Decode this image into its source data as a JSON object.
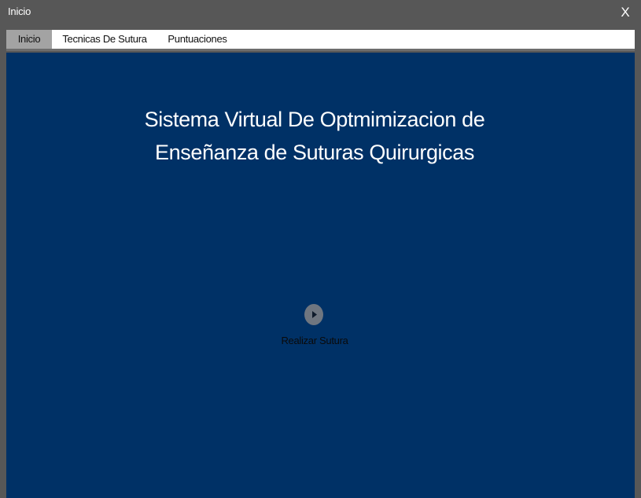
{
  "window": {
    "title": "Inicio",
    "close_label": "X"
  },
  "tabs": [
    {
      "label": "Inicio",
      "active": true
    },
    {
      "label": "Tecnicas De Sutura",
      "active": false
    },
    {
      "label": "Puntuaciones",
      "active": false
    }
  ],
  "main": {
    "heading_line1": "Sistema Virtual De Optmimizacion de",
    "heading_line2": "Enseñanza de Suturas Quirurgicas",
    "action_icon": "play-icon",
    "action_label": "Realizar Sutura"
  },
  "colors": {
    "frame": "#575757",
    "content_background": "#003166",
    "active_tab": "#a3a3a3",
    "heading_text": "#ffffff"
  }
}
